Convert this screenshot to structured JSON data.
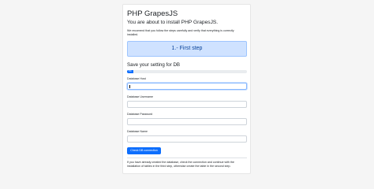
{
  "page": {
    "title": "PHP GrapesJS",
    "subtitle": "You are about to install PHP GrapesJS.",
    "description": "We recomend that you follow the steps carefully and verify that everything is correctly installed."
  },
  "step_banner": {
    "label": "1.- First step"
  },
  "section": {
    "title": "Save your setting for DB"
  },
  "progress": {
    "value_percent": 5,
    "label": "5%"
  },
  "form": {
    "host_label": "Database Host",
    "host_value": "",
    "username_label": "Database Username",
    "username_value": "",
    "password_label": "Database Password",
    "password_value": "",
    "name_label": "Database Name",
    "name_value": "",
    "check_button_label": "Check DB connection"
  },
  "footer_text": "If you have already created the database, check the connection and continue with the installation of tables in the third step, otherwise create the table in the second step.",
  "colors": {
    "primary": "#0d6efd",
    "alert_bg": "#cfe2ff",
    "alert_text": "#084298"
  }
}
